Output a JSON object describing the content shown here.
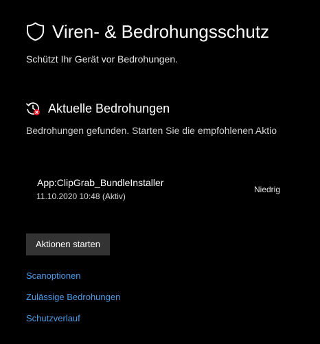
{
  "header": {
    "icon": "shield-icon",
    "title": "Viren- & Bedrohungsschutz",
    "subtitle": "Schützt Ihr Gerät vor Bedrohungen."
  },
  "current_threats": {
    "icon": "history-alert-icon",
    "title": "Aktuelle Bedrohungen",
    "description": "Bedrohungen gefunden. Starten Sie die empfohlenen Aktio",
    "items": [
      {
        "name": "App:ClipGrab_BundleInstaller",
        "date": "11.10.2020 10:48 (Aktiv)",
        "severity": "Niedrig"
      }
    ],
    "action_button": "Aktionen starten"
  },
  "links": [
    {
      "label": "Scanoptionen"
    },
    {
      "label": "Zulässige Bedrohungen"
    },
    {
      "label": "Schutzverlauf"
    }
  ],
  "colors": {
    "background": "#000000",
    "text": "#ffffff",
    "secondary_text": "#d0d0d0",
    "link": "#4d9ce8",
    "button": "#333333",
    "alert": "#e81123"
  }
}
